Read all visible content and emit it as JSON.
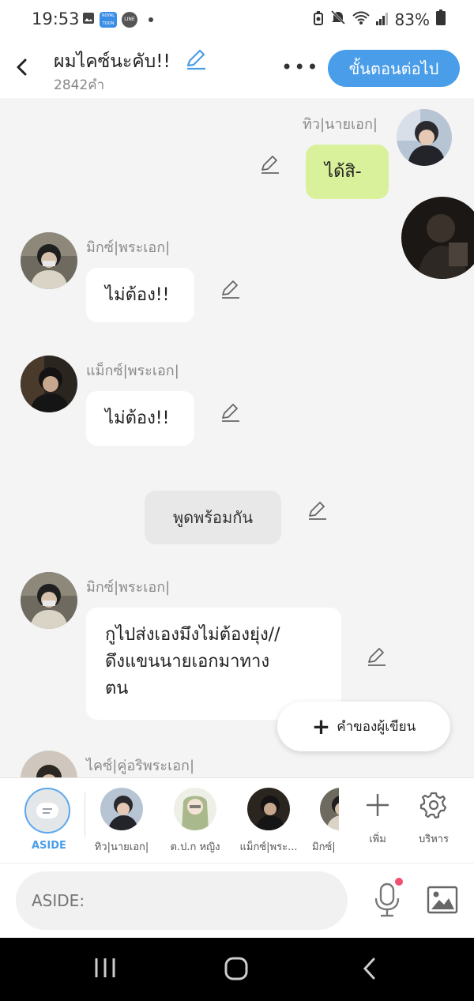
{
  "status_bar": {
    "time": "19:53",
    "battery": "83%",
    "notif_line": "LINE",
    "notif_webtoon": "ROYAL TOON"
  },
  "header": {
    "title": "ผมไคซ์นะคับ!!",
    "word_count": "2842คำ",
    "more_label": "•••",
    "next_button": "ขั้นตอนต่อไป"
  },
  "messages": [
    {
      "speaker": "ทิว|นายเอก|",
      "text": "ได้สิ-",
      "side": "right",
      "style": "green"
    },
    {
      "speaker": "มิกซ์|พระเอก|",
      "text": "ไม่ต้อง!!",
      "side": "left"
    },
    {
      "speaker": "แม็กซ์|พระเอก|",
      "text": "ไม่ต้อง!!",
      "side": "left"
    },
    {
      "speaker": "",
      "text": "พูดพร้อมกัน",
      "side": "center",
      "style": "gray"
    },
    {
      "speaker": "มิกซ์|พระเอก|",
      "text_lines": [
        "กูไปส่งเองมึงไม่ต้องยุ่ง//",
        "ดึงแขนนายเอกมาทาง",
        "ตน"
      ],
      "side": "left"
    },
    {
      "speaker": "ไคซ์|คู่อริพระเอก|",
      "side": "left"
    }
  ],
  "float_button": {
    "plus": "+",
    "label": "คำของผู้เขียน"
  },
  "characters": {
    "aside_label": "ASIDE",
    "items": [
      {
        "label": "ทิว|นายเอก|"
      },
      {
        "label": "ต.ป.ก หญิง"
      },
      {
        "label": "แม็กซ์|พระ..."
      },
      {
        "label": "มิกซ์|"
      }
    ],
    "add_label": "เพิ่ม",
    "manage_label": "บริหาร"
  },
  "input": {
    "placeholder": "ASIDE:"
  },
  "colors": {
    "accent": "#4a9de9",
    "green_bubble": "#d8f19a",
    "chat_bg": "#f4f4f4",
    "mic_dot": "#f0506e"
  }
}
